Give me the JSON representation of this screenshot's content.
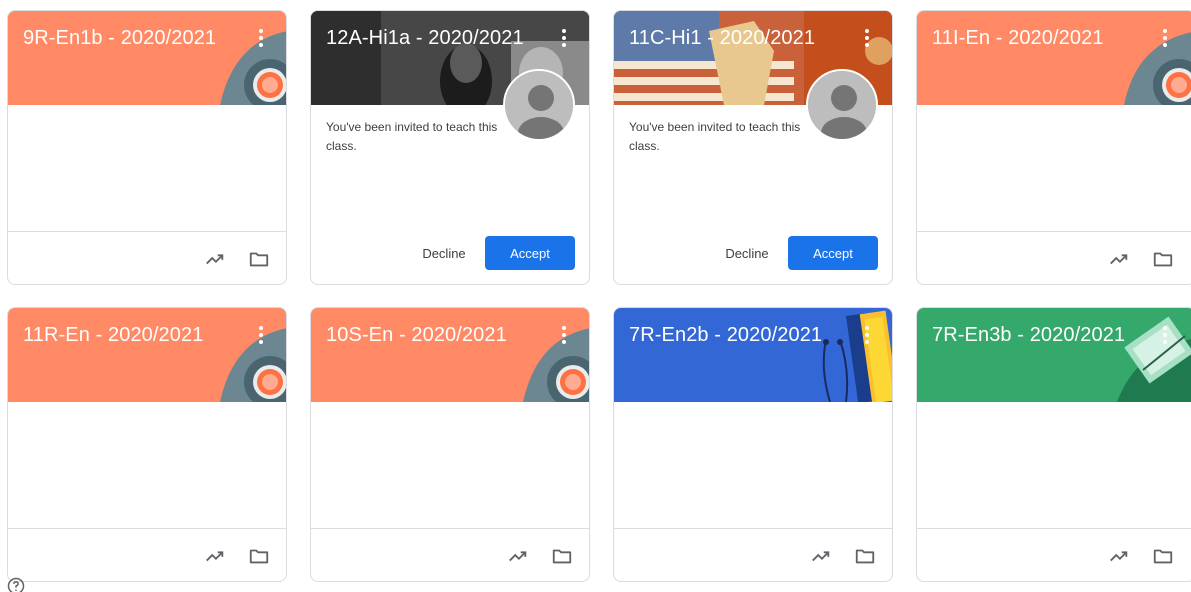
{
  "cards": [
    {
      "id": "c1",
      "title": "9R-En1b - 2020/2021",
      "theme": "orange"
    },
    {
      "id": "c2",
      "title": "12A-Hi1a - 2020/2021",
      "theme": "photo-bw",
      "invite_text": "You've been invited to teach this class.",
      "decline_label": "Decline",
      "accept_label": "Accept"
    },
    {
      "id": "c3",
      "title": "11C-Hi1 - 2020/2021",
      "theme": "poster",
      "invite_text": "You've been invited to teach this class.",
      "decline_label": "Decline",
      "accept_label": "Accept"
    },
    {
      "id": "c4",
      "title": "11I-En - 2020/2021",
      "theme": "orange"
    },
    {
      "id": "c5",
      "title": "11R-En - 2020/2021",
      "theme": "orange"
    },
    {
      "id": "c6",
      "title": "10S-En - 2020/2021",
      "theme": "orange"
    },
    {
      "id": "c7",
      "title": "7R-En2b - 2020/2021",
      "theme": "blue"
    },
    {
      "id": "c8",
      "title": "7R-En3b - 2020/2021",
      "theme": "green"
    }
  ],
  "colors": {
    "orange": "#ff8a65",
    "blue": "#3367d6",
    "green": "#35a86b",
    "accent": "#1a73e8",
    "border": "#dadce0"
  },
  "icons": [
    "more-vert-icon",
    "trending-up-icon",
    "folder-icon",
    "help-icon",
    "avatar-placeholder-icon"
  ]
}
